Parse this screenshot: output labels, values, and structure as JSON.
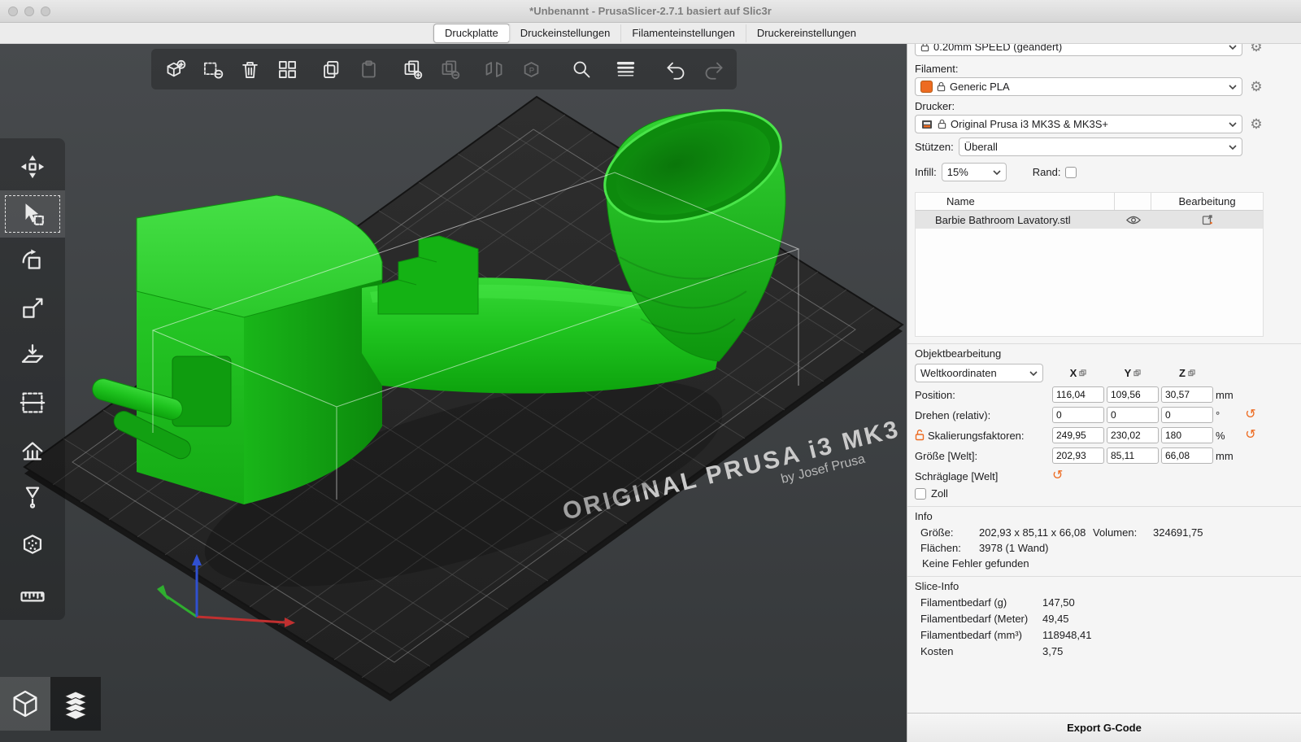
{
  "window": {
    "title": "*Unbenannt - PrusaSlicer-2.7.1 basiert auf Slic3r"
  },
  "tabs": [
    {
      "label": "Druckplatte"
    },
    {
      "label": "Druckeinstellungen"
    },
    {
      "label": "Filamenteinstellungen"
    },
    {
      "label": "Druckereinstellungen"
    }
  ],
  "colors": {
    "accent": "#ED6B21",
    "model_green": "#1BC21B",
    "bed": "#262626",
    "viewport_bg": "#3D4043",
    "selected_row": "#E4E4E4"
  },
  "viewport": {
    "bed_brand": "ORIGINAL PRUSA i3 MK3",
    "bed_brand_sub": "by Josef Prusa"
  },
  "toolbars": {
    "top": [
      "add",
      "delete",
      "delete-all",
      "arrange",
      "copy",
      "paste",
      "add-instance",
      "remove-instance",
      "split-to-objects",
      "split-to-parts",
      "search",
      "variable-layer-height",
      "undo",
      "redo"
    ],
    "left": [
      "move",
      "select",
      "rotate",
      "scale",
      "place-on-face",
      "cut",
      "paint-supports",
      "seam",
      "fuzzy-skin",
      "measure"
    ],
    "view_modes": [
      "3d-editor",
      "preview"
    ]
  },
  "sidebar": {
    "print_profile": "0.20mm SPEED (geändert)",
    "filament_label": "Filament:",
    "filament_value": "Generic PLA",
    "printer_label": "Drucker:",
    "printer_value": "Original Prusa i3 MK3S & MK3S+",
    "supports_label": "Stützen:",
    "supports_value": "Überall",
    "infill_label": "Infill:",
    "infill_value": "15%",
    "brim_label": "Rand:",
    "object_table": {
      "col_name": "Name",
      "col_edit": "Bearbeitung",
      "rows": [
        {
          "name": "Barbie Bathroom Lavatory.stl"
        }
      ]
    },
    "manipulation": {
      "title": "Objektbearbeitung",
      "coord_system": "Weltkoordinaten",
      "axes": {
        "x": "X",
        "y": "Y",
        "z": "Z"
      },
      "rows": {
        "position": {
          "label": "Position:",
          "x": "116,04",
          "y": "109,56",
          "z": "30,57",
          "unit": "mm"
        },
        "rotation": {
          "label": "Drehen (relativ):",
          "x": "0",
          "y": "0",
          "z": "0",
          "unit": "°"
        },
        "scale": {
          "label": "Skalierungsfaktoren:",
          "x": "249,95",
          "y": "230,02",
          "z": "180",
          "unit": "%"
        },
        "size": {
          "label": "Größe [Welt]:",
          "x": "202,93",
          "y": "85,11",
          "z": "66,08",
          "unit": "mm"
        }
      },
      "skew_label": "Schräglage [Welt]",
      "inches_label": "Zoll"
    },
    "info": {
      "title": "Info",
      "size_label": "Größe:",
      "size_value": "202,93 x 85,11 x 66,08",
      "volume_label": "Volumen:",
      "volume_value": "324691,75",
      "facets_label": "Flächen:",
      "facets_value": "3978 (1 Wand)",
      "errors": "Keine Fehler gefunden"
    },
    "slice_info": {
      "title": "Slice-Info",
      "rows": [
        {
          "label": "Filamentbedarf (g)",
          "value": "147,50"
        },
        {
          "label": "Filamentbedarf (Meter)",
          "value": "49,45"
        },
        {
          "label": "Filamentbedarf (mm³)",
          "value": "118948,41"
        },
        {
          "label": "Kosten",
          "value": "3,75"
        }
      ]
    },
    "export_button": "Export G-Code"
  }
}
